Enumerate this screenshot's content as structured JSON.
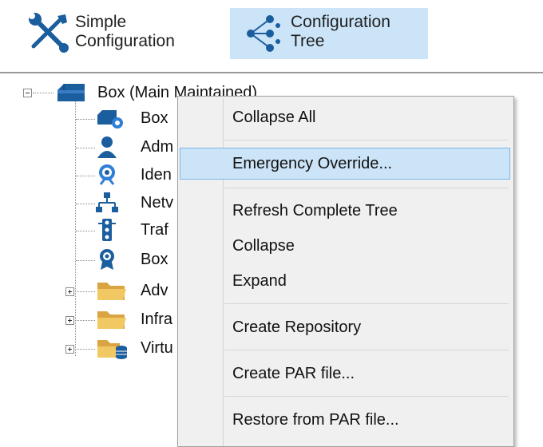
{
  "toolbar": {
    "simple": {
      "line1": "Simple",
      "line2": "Configuration",
      "icon": "wrench-screwdriver-icon"
    },
    "tree": {
      "line1": "Configuration",
      "line2": "Tree",
      "icon": "share-tree-icon",
      "selected": true
    }
  },
  "tree": {
    "root": {
      "label": "Box (Main Maintained)",
      "icon": "server-box-icon",
      "expanded": true
    },
    "children": [
      {
        "label": "Box",
        "icon": "box-settings-icon"
      },
      {
        "label": "Adm",
        "icon": "user-icon"
      },
      {
        "label": "Iden",
        "icon": "identity-gear-icon"
      },
      {
        "label": "Netv",
        "icon": "network-icon"
      },
      {
        "label": "Traf",
        "icon": "traffic-light-icon"
      },
      {
        "label": "Box",
        "icon": "certificate-badge-icon"
      },
      {
        "label": "Adv",
        "icon": "folder-icon",
        "expandable": true
      },
      {
        "label": "Infra",
        "icon": "folder-icon",
        "expandable": true
      },
      {
        "label": "Virtu",
        "icon": "folder-database-icon",
        "expandable": true
      }
    ]
  },
  "context_menu": {
    "items": [
      {
        "label": "Collapse All"
      },
      {
        "label": "Emergency Override...",
        "highlighted": true
      },
      {
        "label": "Refresh Complete Tree"
      },
      {
        "label": "Collapse"
      },
      {
        "label": "Expand"
      },
      {
        "label": "Create Repository"
      },
      {
        "label": "Create PAR file..."
      },
      {
        "label": "Restore from PAR file..."
      }
    ]
  },
  "colors": {
    "selection": "#cce4f7",
    "selection_border": "#7eb4ea",
    "icon_blue": "#1b5e9e",
    "folder_yellow": "#e8b84a",
    "menu_bg": "#f0f0f0"
  }
}
